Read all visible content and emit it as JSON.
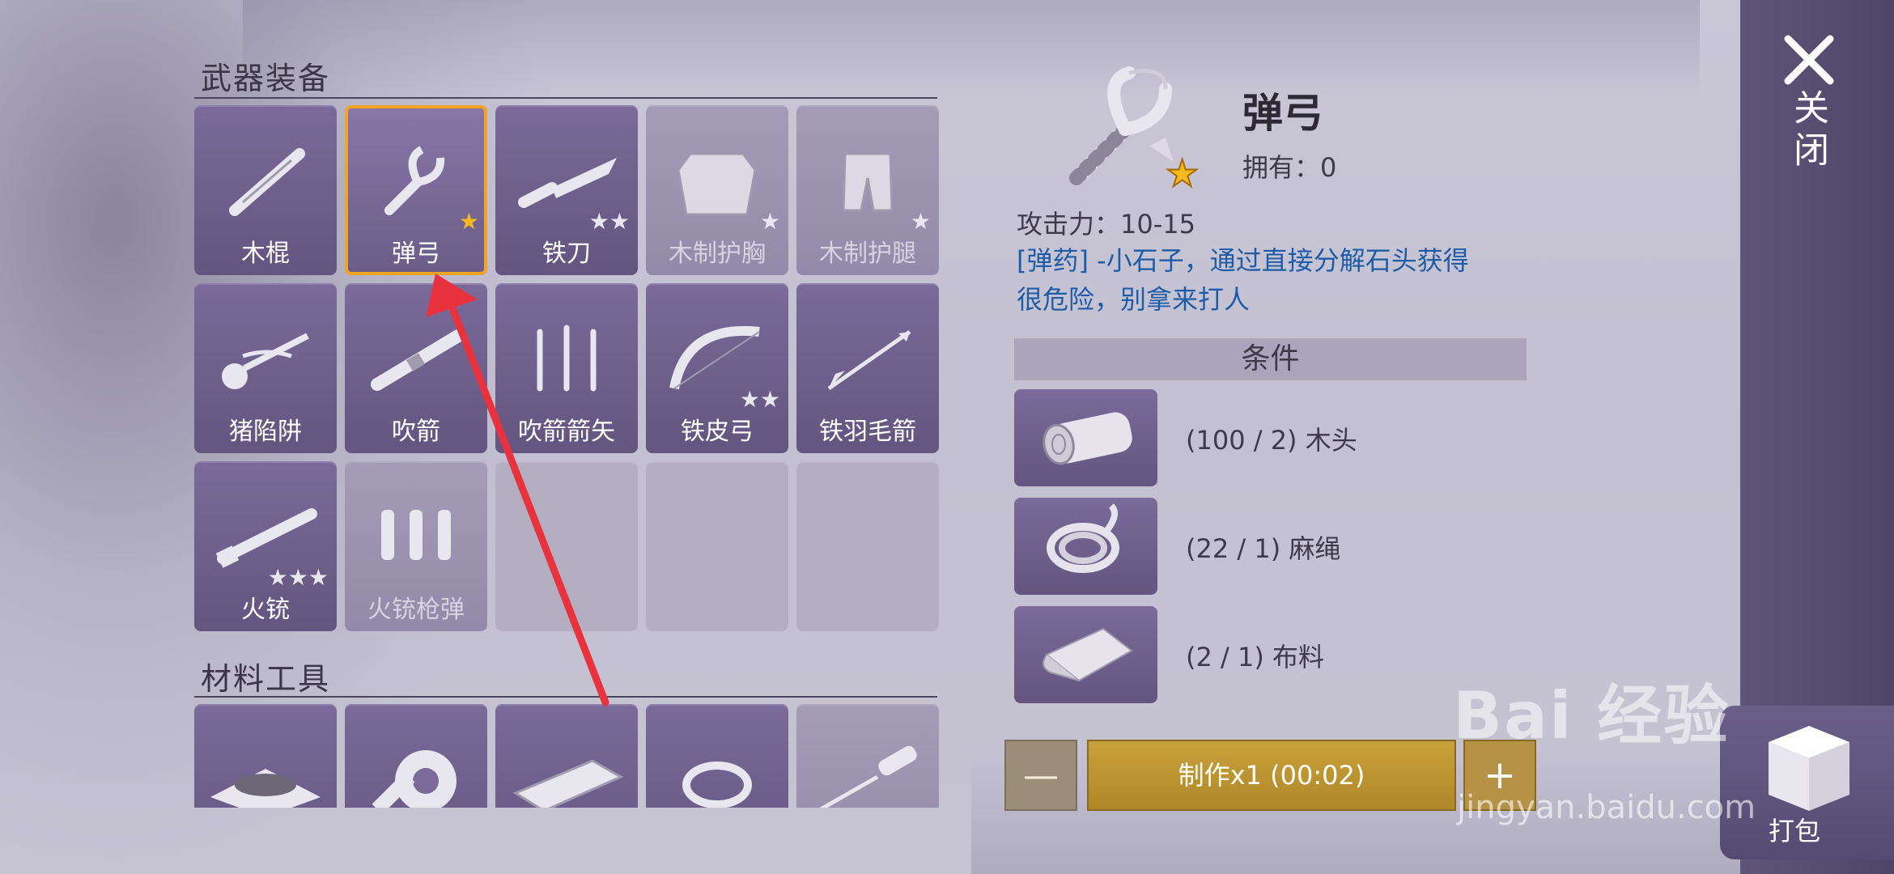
{
  "sections": {
    "weapons_title": "武器装备",
    "materials_title": "材料工具"
  },
  "weapons": [
    {
      "name": "木棍",
      "stars": 0,
      "locked": false,
      "icon": "stick-icon"
    },
    {
      "name": "弹弓",
      "stars": 1,
      "star_color": "gold",
      "locked": false,
      "selected": true,
      "icon": "slingshot-icon"
    },
    {
      "name": "铁刀",
      "stars": 2,
      "locked": false,
      "icon": "knife-icon"
    },
    {
      "name": "木制护胸",
      "stars": 1,
      "locked": true,
      "icon": "chest-armor-icon"
    },
    {
      "name": "木制护腿",
      "stars": 1,
      "locked": true,
      "icon": "leg-armor-icon"
    },
    {
      "name": "猪陷阱",
      "stars": 0,
      "locked": false,
      "icon": "pig-trap-icon"
    },
    {
      "name": "吹箭",
      "stars": 0,
      "locked": false,
      "icon": "blowgun-icon"
    },
    {
      "name": "吹箭箭矢",
      "stars": 0,
      "locked": false,
      "icon": "darts-icon"
    },
    {
      "name": "铁皮弓",
      "stars": 2,
      "locked": false,
      "icon": "bow-icon"
    },
    {
      "name": "铁羽毛箭",
      "stars": 0,
      "locked": false,
      "icon": "arrow-icon"
    },
    {
      "name": "火铳",
      "stars": 3,
      "locked": false,
      "icon": "musket-icon"
    },
    {
      "name": "火铳枪弹",
      "stars": 0,
      "locked": true,
      "icon": "bullets-icon"
    }
  ],
  "materials_row": [
    {
      "icon": "gravel-pile-icon"
    },
    {
      "icon": "tape-roll-icon"
    },
    {
      "icon": "wood-plank-icon"
    },
    {
      "icon": "rope-icon"
    },
    {
      "icon": "screwdriver-icon",
      "locked": true
    }
  ],
  "detail": {
    "title": "弹弓",
    "owned": "拥有：0",
    "attack": "攻击力：10-15",
    "desc_line1": "[弹药] -小石子，通过直接分解石头获得",
    "desc_line2": "很危险，别拿来打人",
    "conditions_label": "条件",
    "requirements": [
      {
        "label": "(100 / 2) 木头",
        "icon": "log-icon"
      },
      {
        "label": "(22 / 1) 麻绳",
        "icon": "rope-icon"
      },
      {
        "label": "(2 / 1) 布料",
        "icon": "cloth-icon"
      }
    ]
  },
  "actions": {
    "minus": "—",
    "craft": "制作x1 (00:02)",
    "plus": "+",
    "close": "关闭",
    "pack": "打包"
  },
  "watermark": {
    "brand": "Bai 经验",
    "url": "jingyan.baidu.com"
  },
  "colors": {
    "tile": "#6f5f8c",
    "selected_border": "#f2a425",
    "desc_text": "#1f5ca8",
    "craft_button": "#c09431",
    "annotation_arrow": "#e8333f"
  }
}
